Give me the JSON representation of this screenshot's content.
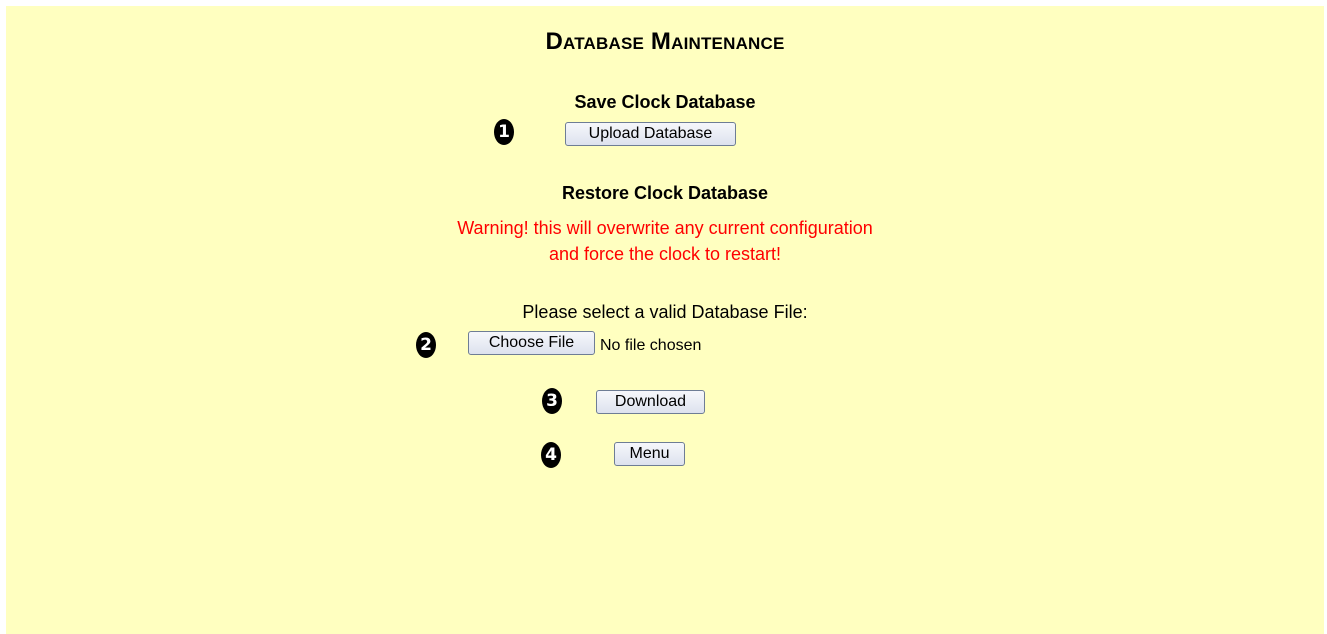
{
  "page": {
    "title": "Database Maintenance",
    "background_color": "#ffffc0",
    "warning_color": "#ff0000"
  },
  "save_section": {
    "heading": "Save Clock Database",
    "upload_button_label": "Upload Database",
    "step_number": "1"
  },
  "restore_section": {
    "heading": "Restore Clock Database",
    "warning_line1": "Warning! this will overwrite any current configuration",
    "warning_line2": "and force the clock to restart!",
    "select_label": "Please select a valid Database File:",
    "choose_file_label": "Choose File",
    "file_status": "No file chosen",
    "file_step_number": "2",
    "download_button_label": "Download",
    "download_step_number": "3"
  },
  "navigation": {
    "menu_button_label": "Menu",
    "menu_step_number": "4"
  }
}
